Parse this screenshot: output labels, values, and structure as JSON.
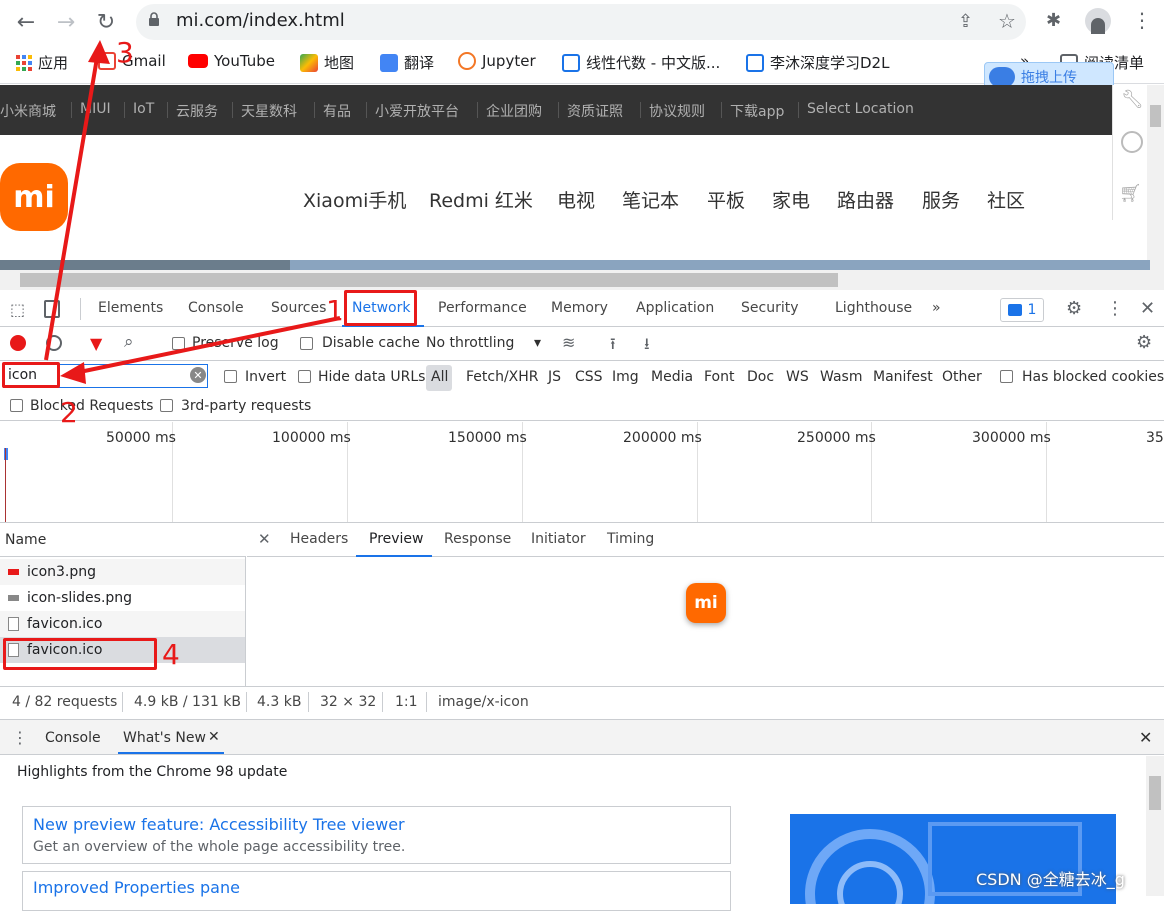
{
  "browser": {
    "url": "mi.com/index.html",
    "bookmarks": [
      "应用",
      "Gmail",
      "YouTube",
      "地图",
      "翻译",
      "Jupyter",
      "线性代数 - 中文版...",
      "李沐深度学习D2L"
    ],
    "bookmarks_overflow": "»",
    "reading_list": "阅读清单",
    "baidu_upload": "拖拽上传"
  },
  "mi_page": {
    "top_nav": [
      "小米商城",
      "MIUI",
      "IoT",
      "云服务",
      "天星数科",
      "有品",
      "小爱开放平台",
      "企业团购",
      "资质证照",
      "协议规则",
      "下载app",
      "Select Location"
    ],
    "logo": "mi",
    "main_nav": [
      "Xiaomi手机",
      "Redmi 红米",
      "电视",
      "笔记本",
      "平板",
      "家电",
      "路由器",
      "服务",
      "社区"
    ]
  },
  "devtools": {
    "tabs": [
      "Elements",
      "Console",
      "Sources",
      "Network",
      "Performance",
      "Memory",
      "Application",
      "Security",
      "Lighthouse"
    ],
    "active_tab": "Network",
    "overflow": "»",
    "issues_count": "1",
    "toolbar": {
      "preserve_log": "Preserve log",
      "disable_cache": "Disable cache",
      "throttling": "No throttling"
    },
    "filter": {
      "value": "icon",
      "invert": "Invert",
      "hide_data_urls": "Hide data URLs",
      "types": [
        "All",
        "Fetch/XHR",
        "JS",
        "CSS",
        "Img",
        "Media",
        "Font",
        "Doc",
        "WS",
        "Wasm",
        "Manifest",
        "Other"
      ],
      "has_blocked_cookies": "Has blocked cookies",
      "blocked_requests": "Blocked Requests",
      "third_party": "3rd-party requests"
    },
    "timeline_labels": [
      "50000 ms",
      "100000 ms",
      "150000 ms",
      "200000 ms",
      "250000 ms",
      "300000 ms",
      "35"
    ],
    "requests": {
      "header": "Name",
      "items": [
        "icon3.png",
        "icon-slides.png",
        "favicon.ico",
        "favicon.ico"
      ]
    },
    "detail_tabs": [
      "Headers",
      "Preview",
      "Response",
      "Initiator",
      "Timing"
    ],
    "active_detail_tab": "Preview",
    "preview_icon": "mi",
    "status": {
      "requests": "4 / 82 requests",
      "transferred": "4.9 kB / 131 kB t",
      "size": "4.3 kB",
      "dimensions": "32 × 32",
      "ratio": "1:1",
      "mime": "image/x-icon"
    },
    "drawer": {
      "tabs": [
        "Console",
        "What's New"
      ],
      "highlights": "Highlights from the Chrome 98 update",
      "cards": [
        {
          "title": "New preview feature: Accessibility Tree viewer",
          "desc": "Get an overview of the whole page accessibility tree."
        },
        {
          "title": "Improved Properties pane",
          "desc": ""
        }
      ]
    }
  },
  "annotations": [
    "1",
    "2",
    "3",
    "4"
  ],
  "watermark": "CSDN @全糖去冰_g"
}
